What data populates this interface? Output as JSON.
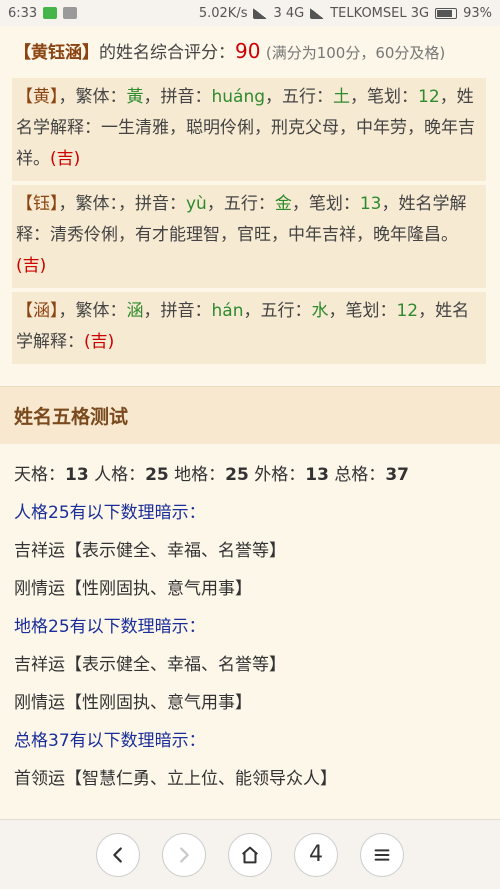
{
  "status": {
    "time": "6:33",
    "speed": "5.02K/s",
    "carrier_left": "3 4G",
    "carrier": "TELKOMSEL 3G",
    "battery": "93%"
  },
  "score": {
    "name": "【黄钰涵】",
    "label": "的姓名综合评分：",
    "value": "90",
    "note": "(满分为100分，60分及格)"
  },
  "chars": [
    {
      "char": "【黄】",
      "fan_label": "，繁体：",
      "fan": "黃",
      "py_label": "，拼音：",
      "py": "huáng",
      "wx_label": "，五行：",
      "wx": "土",
      "bh_label": "，笔划：",
      "bh": "12",
      "desc": "，姓名学解释：一生清雅，聪明伶俐，刑克父母，中年劳，晚年吉祥。",
      "luck": "(吉)"
    },
    {
      "char": "【钰】",
      "fan_label": "，繁体：",
      "fan": "",
      "py_label": "，拼音：",
      "py": "yù",
      "wx_label": "，五行：",
      "wx": "金",
      "bh_label": "，笔划：",
      "bh": "13",
      "desc": "，姓名学解释：清秀伶俐，有才能理智，官旺，中年吉祥，晚年隆昌。",
      "luck": "(吉)"
    },
    {
      "char": "【涵】",
      "fan_label": "，繁体：",
      "fan": "涵",
      "py_label": "，拼音：",
      "py": "hán",
      "wx_label": "，五行：",
      "wx": "水",
      "bh_label": "，笔划：",
      "bh": "12",
      "desc": "，姓名学解释：",
      "luck": "(吉)"
    }
  ],
  "section_title": "姓名五格测试",
  "wuge": {
    "tian_label": "天格：",
    "tian": "13",
    "ren_label": "人格：",
    "ren": "25",
    "di_label": "地格：",
    "di": "25",
    "wai_label": "外格：",
    "wai": "13",
    "zong_label": "总格：",
    "zong": "37"
  },
  "hints": [
    {
      "head": "人格25有以下数理暗示：",
      "lines": [
        "吉祥运【表示健全、幸福、名誉等】",
        "刚情运【性刚固执、意气用事】"
      ]
    },
    {
      "head": "地格25有以下数理暗示：",
      "lines": [
        "吉祥运【表示健全、幸福、名誉等】",
        "刚情运【性刚固执、意气用事】"
      ]
    },
    {
      "head": "总格37有以下数理暗示：",
      "lines": [
        "首领运【智慧仁勇、立上位、能领导众人】"
      ]
    }
  ],
  "nav": {
    "back_icon": "chevron-left-icon",
    "forward_icon": "chevron-right-icon",
    "home_icon": "home-icon",
    "tabs": "4",
    "menu_icon": "menu-icon"
  }
}
